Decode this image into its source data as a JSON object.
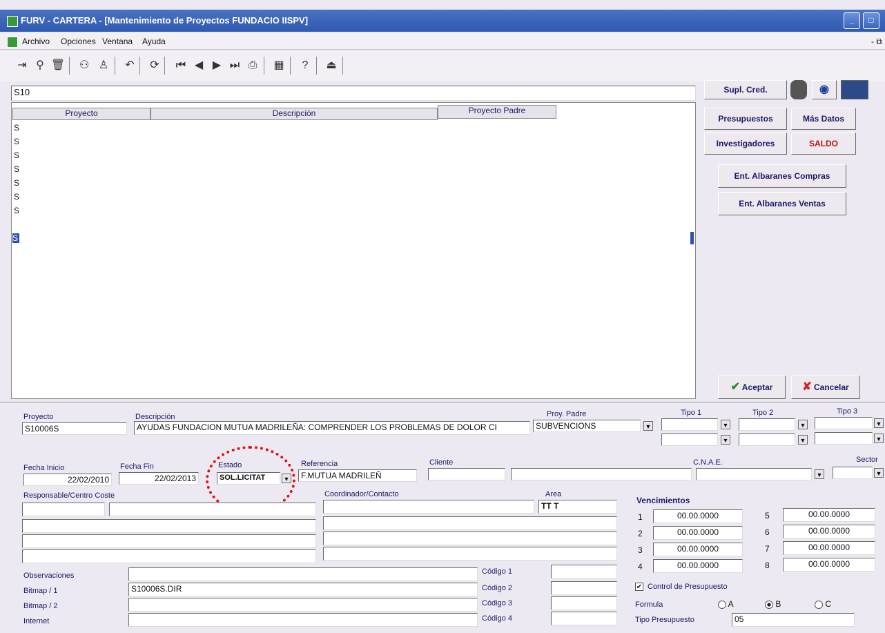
{
  "window": {
    "title": "FURV - CARTERA - [Mantenimiento de Proyectos FUNDACIO IISPV]"
  },
  "menu": [
    "Archivo",
    "Opciones",
    "Ventana",
    "Ayuda"
  ],
  "search": {
    "value": "S10"
  },
  "grid": {
    "headers": [
      "Proyecto",
      "Descripción",
      "Proyecto Padre"
    ],
    "rows": [
      "S",
      "S",
      "S",
      "S",
      "S",
      "S",
      "S",
      "S"
    ]
  },
  "side_buttons": {
    "supl_cred": "Supl. Cred.",
    "presupuestos": "Presupuestos",
    "mas_datos": "Más Datos",
    "investigadores": "Investigadores",
    "saldo": "SALDO",
    "ent_compras": "Ent. Albaranes Compras",
    "ent_ventas": "Ent. Albaranes Ventas",
    "aceptar": "Aceptar",
    "cancelar": "Cancelar"
  },
  "form": {
    "proyecto_label": "Proyecto",
    "proyecto_value": "S10006S",
    "descripcion_label": "Descripción",
    "descripcion_value": "AYUDAS FUNDACION MUTUA MADRILEÑA: COMPRENDER LOS PROBLEMAS DE DOLOR CI",
    "proy_padre_label": "Proy. Padre",
    "proy_padre_value": "SUBVENCIONS",
    "tipo1_label": "Tipo 1",
    "tipo2_label": "Tipo 2",
    "tipo3_label": "Tipo 3",
    "fecha_inicio_label": "Fecha Inicio",
    "fecha_inicio_value": "22/02/2010",
    "fecha_fin_label": "Fecha Fin",
    "fecha_fin_value": "22/02/2013",
    "estado_label": "Estado",
    "estado_value": "SOL.LICITAT",
    "referencia_label": "Referencia",
    "referencia_value": "F.MUTUA MADRILEÑ",
    "cliente_label": "Cliente",
    "cnae_label": "C.N.A.E.",
    "sector_label": "Sector",
    "responsable_label": "Responsable/Centro Coste",
    "coordinador_label": "Coordinador/Contacto",
    "area_label": "Area",
    "area_value": "TT T",
    "vencimientos_label": "Vencimientos",
    "vencimientos": [
      {
        "n": "1",
        "v": "00.00.0000"
      },
      {
        "n": "2",
        "v": "00.00.0000"
      },
      {
        "n": "3",
        "v": "00.00.0000"
      },
      {
        "n": "4",
        "v": "00.00.0000"
      },
      {
        "n": "5",
        "v": "00.00.0000"
      },
      {
        "n": "6",
        "v": "00.00.0000"
      },
      {
        "n": "7",
        "v": "00.00.0000"
      },
      {
        "n": "8",
        "v": "00.00.0000"
      }
    ],
    "observaciones_label": "Observaciones",
    "bitmap1_label": "Bitmap / 1",
    "bitmap1_value": "S10006S.DIR",
    "bitmap2_label": "Bitmap / 2",
    "internet_label": "Internet",
    "codigo1_label": "Código 1",
    "codigo2_label": "Código 2",
    "codigo3_label": "Código 3",
    "codigo4_label": "Código 4",
    "control_label": "Control de Presupuesto",
    "formula_label": "Formula",
    "formula_a": "A",
    "formula_b": "B",
    "formula_c": "C",
    "tipo_presupuesto_label": "Tipo Presupuesto",
    "tipo_presupuesto_value": "05"
  },
  "colors": {
    "highlight_circle": "#e01010",
    "titlebar": "#2e5ab0"
  }
}
